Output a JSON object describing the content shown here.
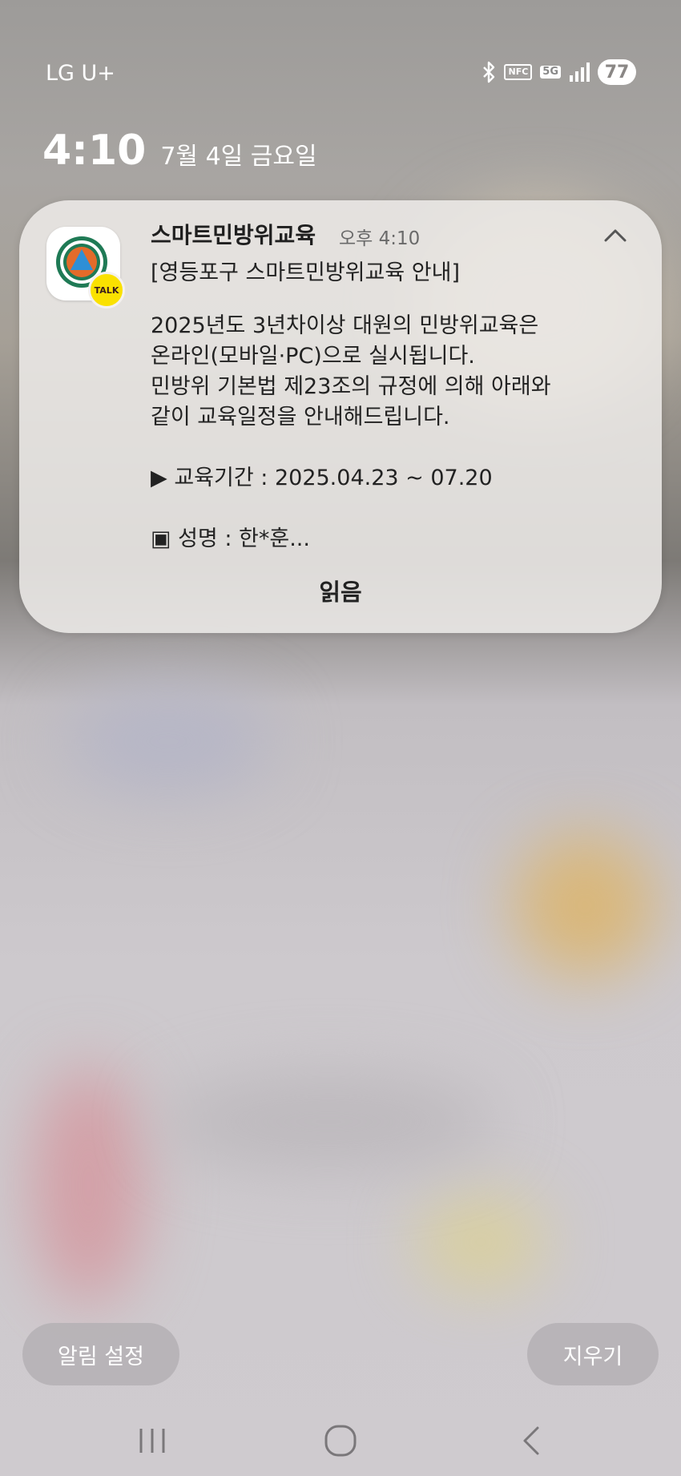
{
  "status_bar": {
    "carrier": "LG U+",
    "icons": [
      "bluetooth-icon",
      "nfc-icon",
      "5g-icon",
      "signal-icon"
    ],
    "nfc_label": "NFC",
    "network_label": "5G",
    "battery": "77"
  },
  "lockscreen": {
    "time": "4:10",
    "date": "7월 4일 금요일"
  },
  "notification": {
    "app_name": "스마트민방위교육",
    "time": "오후 4:10",
    "title": "[영등포구 스마트민방위교육 안내]",
    "body_lines": [
      "2025년도 3년차이상 대원의 민방위교육은",
      "온라인(모바일·PC)으로 실시됩니다.",
      "민방위 기본법 제23조의 규정에 의해 아래와",
      "같이 교육일정을 안내해드립니다.",
      "▶ 교육기간 : 2025.04.23 ~ 07.20",
      "▣ 성명 : 한*훈..."
    ],
    "badge_label": "TALK",
    "action_read": "읽음",
    "badge_color": "#fae100"
  },
  "bottom_actions": {
    "settings": "알림 설정",
    "clear": "지우기"
  },
  "nav": [
    "recents-icon",
    "home-icon",
    "back-icon"
  ]
}
